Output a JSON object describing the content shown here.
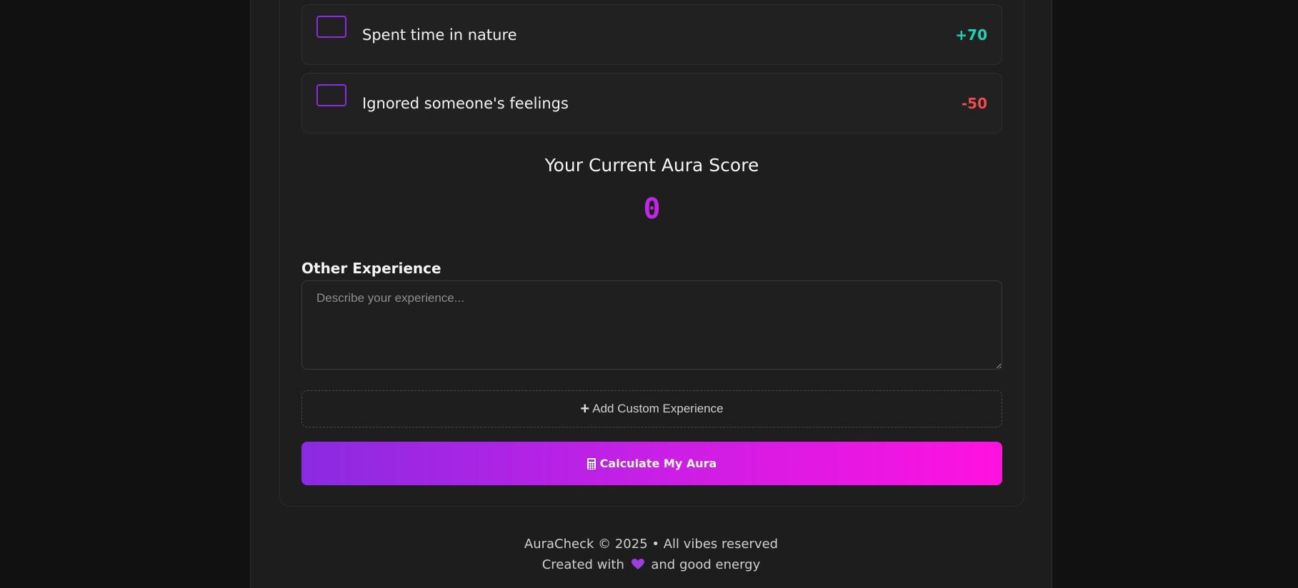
{
  "experiences": [
    {
      "label": "Spent time in nature",
      "points": "+70",
      "color": "#17d8b4",
      "checked": false
    },
    {
      "label": "Ignored someone's feelings",
      "points": "-50",
      "color": "#ef4b4b",
      "checked": false
    }
  ],
  "score": {
    "title": "Your Current Aura Score",
    "value": "0",
    "color": "#c026e6"
  },
  "other": {
    "label": "Other Experience",
    "placeholder": "Describe your experience...",
    "value": ""
  },
  "buttons": {
    "add_custom": "Add Custom Experience",
    "add_custom_icon": "plus-icon",
    "calculate": "Calculate My Aura",
    "calculate_icon": "calculator-icon"
  },
  "footer": {
    "copyright": "AuraCheck © 2025 • All vibes reserved",
    "created_prefix": "Created with",
    "heart_icon": "purple-heart-icon",
    "created_suffix": "and good energy"
  },
  "colors": {
    "accent": "#8b2be2",
    "gradient_start": "#8a2be2",
    "gradient_end": "#ff12e0",
    "positive": "#17d8b4",
    "negative": "#ef4b4b"
  }
}
